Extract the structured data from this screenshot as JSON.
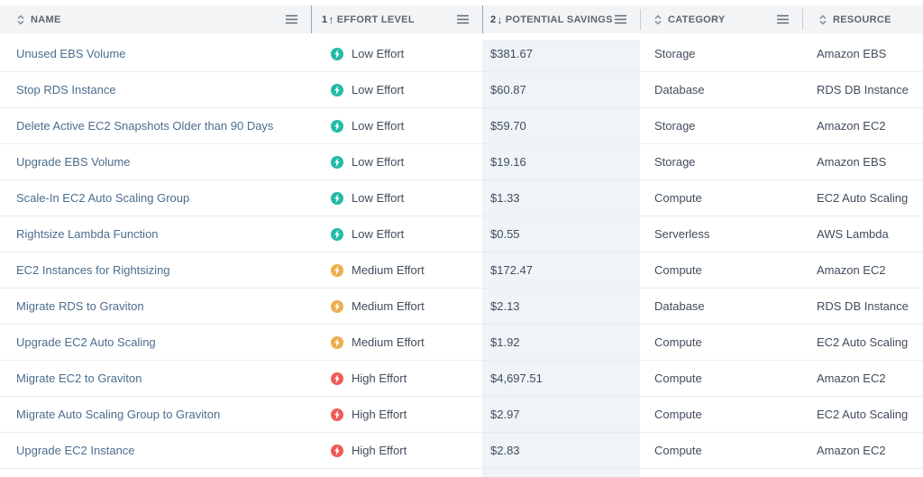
{
  "table": {
    "columns": [
      {
        "label": "NAME",
        "sort": "none",
        "sort_order": "",
        "sort_arrow": "",
        "menu": true
      },
      {
        "label": "EFFORT LEVEL",
        "sort": "asc",
        "sort_order": "1",
        "sort_arrow": "↑",
        "menu": true
      },
      {
        "label": "POTENTIAL SAVINGS",
        "sort": "desc",
        "sort_order": "2",
        "sort_arrow": "↓",
        "menu": true,
        "highlighted": true
      },
      {
        "label": "CATEGORY",
        "sort": "none",
        "sort_order": "",
        "sort_arrow": "",
        "menu": true
      },
      {
        "label": "RESOURCE",
        "sort": "none",
        "sort_order": "",
        "sort_arrow": "",
        "menu": false
      }
    ],
    "rows": [
      {
        "name": "Unused EBS Volume",
        "effort": "Low Effort",
        "effort_level": "low",
        "savings": "$381.67",
        "category": "Storage",
        "resource": "Amazon EBS"
      },
      {
        "name": "Stop RDS Instance",
        "effort": "Low Effort",
        "effort_level": "low",
        "savings": "$60.87",
        "category": "Database",
        "resource": "RDS DB Instance"
      },
      {
        "name": "Delete Active EC2 Snapshots Older than 90 Days",
        "effort": "Low Effort",
        "effort_level": "low",
        "savings": "$59.70",
        "category": "Storage",
        "resource": "Amazon EC2"
      },
      {
        "name": "Upgrade EBS Volume",
        "effort": "Low Effort",
        "effort_level": "low",
        "savings": "$19.16",
        "category": "Storage",
        "resource": "Amazon EBS"
      },
      {
        "name": "Scale-In EC2 Auto Scaling Group",
        "effort": "Low Effort",
        "effort_level": "low",
        "savings": "$1.33",
        "category": "Compute",
        "resource": "EC2 Auto Scaling"
      },
      {
        "name": "Rightsize Lambda Function",
        "effort": "Low Effort",
        "effort_level": "low",
        "savings": "$0.55",
        "category": "Serverless",
        "resource": "AWS Lambda"
      },
      {
        "name": "EC2 Instances for Rightsizing",
        "effort": "Medium Effort",
        "effort_level": "medium",
        "savings": "$172.47",
        "category": "Compute",
        "resource": "Amazon EC2"
      },
      {
        "name": "Migrate RDS to Graviton",
        "effort": "Medium Effort",
        "effort_level": "medium",
        "savings": "$2.13",
        "category": "Database",
        "resource": "RDS DB Instance"
      },
      {
        "name": "Upgrade EC2 Auto Scaling",
        "effort": "Medium Effort",
        "effort_level": "medium",
        "savings": "$1.92",
        "category": "Compute",
        "resource": "EC2 Auto Scaling"
      },
      {
        "name": "Migrate EC2 to Graviton",
        "effort": "High Effort",
        "effort_level": "high",
        "savings": "$4,697.51",
        "category": "Compute",
        "resource": "Amazon EC2"
      },
      {
        "name": "Migrate Auto Scaling Group to Graviton",
        "effort": "High Effort",
        "effort_level": "high",
        "savings": "$2.97",
        "category": "Compute",
        "resource": "EC2 Auto Scaling"
      },
      {
        "name": "Upgrade EC2 Instance",
        "effort": "High Effort",
        "effort_level": "high",
        "savings": "$2.83",
        "category": "Compute",
        "resource": "Amazon EC2"
      }
    ]
  },
  "colors": {
    "effort_low": "#23bba4",
    "effort_medium": "#eead4d",
    "effort_high": "#f15b57",
    "sorted_column_bg": "#eff4f8",
    "header_bg": "#f3f4f5",
    "name_link": "#4c6d8e"
  }
}
